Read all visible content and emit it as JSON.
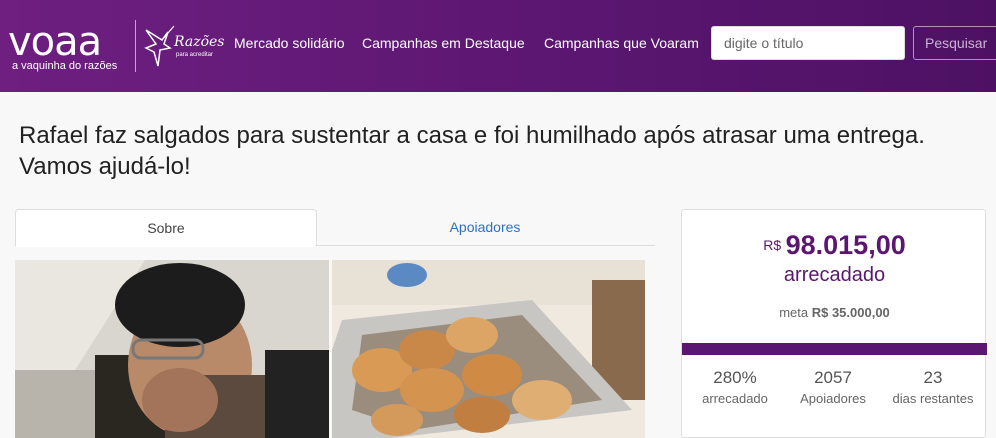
{
  "header": {
    "brand": {
      "name": "voaa",
      "tagline": "a vaquinha do razões",
      "partner": "Razões",
      "partner_sub": "para acreditar"
    },
    "nav": [
      "Mercado solidário",
      "Campanhas em Destaque",
      "Campanhas que Voaram"
    ],
    "search": {
      "placeholder": "digite o título",
      "button": "Pesquisar"
    }
  },
  "campaign": {
    "title": "Rafael faz salgados para sustentar a casa e foi humilhado após atrasar uma entrega. Vamos ajudá-lo!"
  },
  "tabs": [
    {
      "label": "Sobre",
      "active": true
    },
    {
      "label": "Apoiadores",
      "active": false
    }
  ],
  "sidebar": {
    "currency": "R$",
    "amount": "98.015,00",
    "raised_label": "arrecadado",
    "goal_prefix": "meta",
    "goal_value": "R$ 35.000,00",
    "progress_fraction": 1.0,
    "stats": [
      {
        "value": "280%",
        "label": "arrecadado"
      },
      {
        "value": "2057",
        "label": "Apoiadores"
      },
      {
        "value": "23",
        "label": "dias restantes"
      }
    ]
  },
  "colors": {
    "brand": "#5a1670",
    "link": "#2a73c9"
  }
}
